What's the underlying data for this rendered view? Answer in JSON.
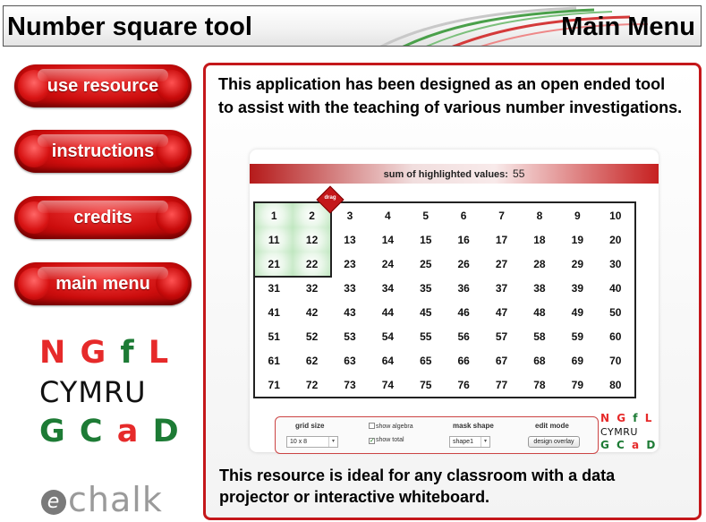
{
  "header": {
    "app_title": "Number square tool",
    "menu_title": "Main Menu"
  },
  "nav": {
    "items": [
      {
        "label": "use resource"
      },
      {
        "label": "instructions"
      },
      {
        "label": "credits"
      },
      {
        "label": "main menu"
      }
    ]
  },
  "logos": {
    "ngfl": {
      "row1": [
        "N",
        "G",
        "f",
        "L"
      ],
      "row2": "CYMRU",
      "row3": [
        "G",
        "C",
        "a",
        "D"
      ]
    },
    "echalk": {
      "e": "e",
      "rest": "chalk"
    }
  },
  "content": {
    "intro": "This application has been designed as an open ended tool to assist with the teaching of various number investigations.",
    "footer": "This resource is ideal for any classroom with a data projector or interactive whiteboard."
  },
  "tool": {
    "sum_label": "sum of highlighted values:",
    "sum_value": "55",
    "drag_label": "drag",
    "grid": {
      "rows": 8,
      "cols": 10,
      "highlighted": [
        1,
        2,
        11,
        12,
        21,
        22
      ]
    },
    "controls": {
      "grid_size_label": "grid size",
      "grid_size_value": "10 x 8",
      "show_algebra_label": "show algebra",
      "show_algebra_checked": false,
      "show_total_label": "show total",
      "show_total_checked": true,
      "mask_shape_label": "mask shape",
      "mask_shape_value": "shape1",
      "edit_mode_label": "edit mode",
      "edit_mode_button": "design overlay"
    }
  },
  "colors": {
    "accent_red": "#c4171a",
    "ngfl_red": "#e62a2a",
    "ngfl_green": "#1d7b35"
  }
}
